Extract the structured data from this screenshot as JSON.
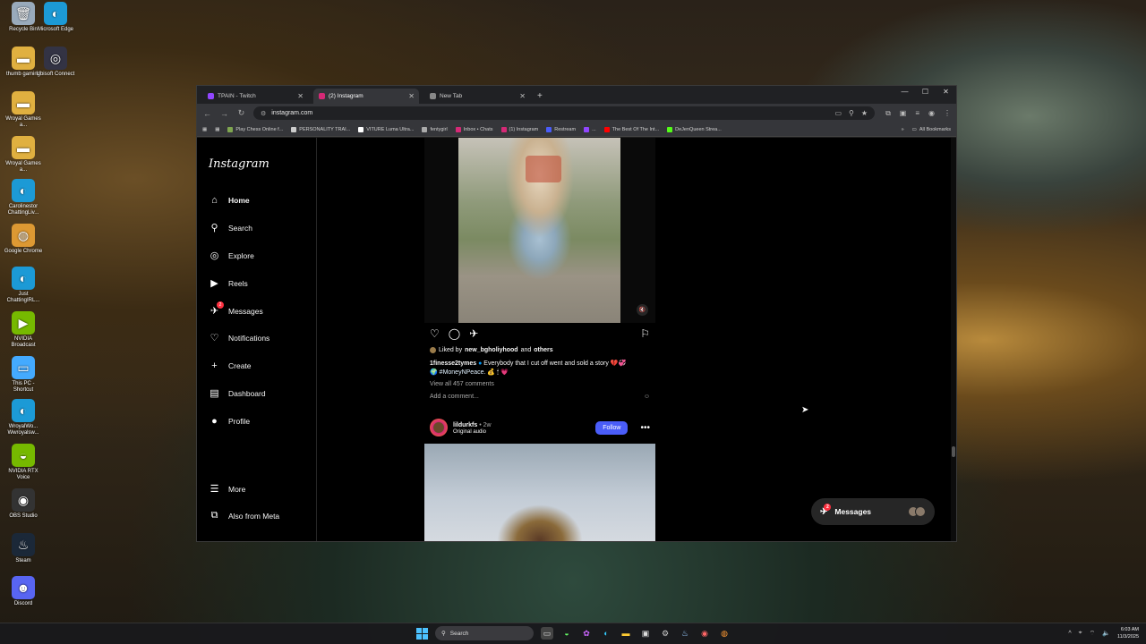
{
  "desktop": {
    "icons": [
      {
        "label": "Recycle Bin",
        "icon": "recycle-bin-icon"
      },
      {
        "label": "Microsoft Edge",
        "icon": "edge-icon"
      },
      {
        "label": "thumb gaming",
        "icon": "folder-icon"
      },
      {
        "label": "Ubisoft Connect",
        "icon": "ubisoft-icon"
      },
      {
        "label": "Wroyal Games a...",
        "icon": "folder-icon"
      },
      {
        "label": "Wroyal Games a...",
        "icon": "folder-icon"
      },
      {
        "label": "Carolinestor ChattingLiv...",
        "icon": "edge-icon"
      },
      {
        "label": "Google Chrome",
        "icon": "chrome-icon"
      },
      {
        "label": "Just ChattingIRL...",
        "icon": "edge-icon"
      },
      {
        "label": "NVIDIA Broadcast",
        "icon": "nvidia-icon"
      },
      {
        "label": "This PC - Shortcut",
        "icon": "pc-icon"
      },
      {
        "label": "WroyalWo... Wwroyalsw...",
        "icon": "edge-icon"
      },
      {
        "label": "NVIDIA RTX Voice",
        "icon": "nvidia-voice-icon"
      },
      {
        "label": "OBS Studio",
        "icon": "obs-icon"
      },
      {
        "label": "Steam",
        "icon": "steam-icon"
      },
      {
        "label": "Discord",
        "icon": "discord-icon"
      }
    ]
  },
  "browser": {
    "tabs": [
      {
        "title": "TPAIN - Twitch",
        "active": false,
        "color": "#9146ff"
      },
      {
        "title": "(2) Instagram",
        "active": true,
        "color": "#d62976"
      },
      {
        "title": "New Tab",
        "active": false,
        "color": "#888888"
      }
    ],
    "address": "instagram.com",
    "bookmarks": [
      {
        "label": "Play Chess Online f...",
        "color": "#7fa650"
      },
      {
        "label": "PERSONALITY TRAI...",
        "color": "#cccccc"
      },
      {
        "label": "VITURE Luma Ultra...",
        "color": "#ffffff"
      },
      {
        "label": "fentygirl",
        "color": "#aaaaaa"
      },
      {
        "label": "Inbox • Chats",
        "color": "#d62976"
      },
      {
        "label": "(1) Instagram",
        "color": "#d62976"
      },
      {
        "label": "Restream",
        "color": "#4a5df9"
      },
      {
        "label": "...",
        "color": "#9146ff"
      },
      {
        "label": "The Best Of The Int...",
        "color": "#ff0000"
      },
      {
        "label": "DeJenQueen Strea...",
        "color": "#53fc18"
      }
    ],
    "all_bookmarks": "All Bookmarks"
  },
  "instagram": {
    "logo": "Instagram",
    "nav": [
      {
        "label": "Home",
        "icon": "home-icon",
        "glyph": "⌂"
      },
      {
        "label": "Search",
        "icon": "search-icon",
        "glyph": "⚲"
      },
      {
        "label": "Explore",
        "icon": "compass-icon",
        "glyph": "◎"
      },
      {
        "label": "Reels",
        "icon": "reels-icon",
        "glyph": "▶"
      },
      {
        "label": "Messages",
        "icon": "messenger-icon",
        "glyph": "✈",
        "badge": "2"
      },
      {
        "label": "Notifications",
        "icon": "heart-icon",
        "glyph": "♡"
      },
      {
        "label": "Create",
        "icon": "plus-icon",
        "glyph": "+"
      },
      {
        "label": "Dashboard",
        "icon": "dashboard-icon",
        "glyph": "▤"
      },
      {
        "label": "Profile",
        "icon": "profile-avatar-icon",
        "glyph": "●"
      }
    ],
    "nav_bottom": [
      {
        "label": "More",
        "icon": "menu-icon",
        "glyph": "☰"
      },
      {
        "label": "Also from Meta",
        "icon": "meta-icon",
        "glyph": "⧉"
      }
    ],
    "post1": {
      "liked_prefix": "Liked by",
      "liked_user": "new_bgholiyhood",
      "liked_and": "and",
      "liked_others": "others",
      "caption_user": "1finesse2tymes",
      "caption_text": "Everybody that I cut off went and sold a story 💔💞",
      "hashtag": "#MoneyNPeace.",
      "caption_tail": "💰 🕯 💗",
      "view_comments": "View all 457 comments",
      "add_comment": "Add a comment..."
    },
    "post2": {
      "user": "lildurkfs",
      "time": "• 2w",
      "audio": "Original audio",
      "follow": "Follow",
      "more": "•••"
    },
    "messages_pill": {
      "label": "Messages",
      "badge": "2"
    }
  },
  "taskbar": {
    "search_placeholder": "Search",
    "time": "6:03 AM",
    "date": "11/3/2025"
  }
}
